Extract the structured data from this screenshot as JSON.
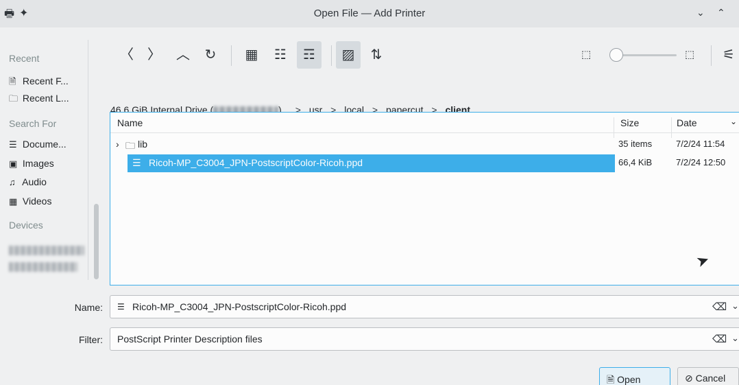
{
  "window": {
    "title": "Open File — Add Printer",
    "left_icons": [
      "printer-icon",
      "pin-icon"
    ],
    "minimize_glyph": "⌄",
    "maximize_glyph": "⌃"
  },
  "places": {
    "recent_header": "Recent",
    "recent_items": [
      {
        "label": "Recent F...",
        "icon": "recent-files-icon"
      },
      {
        "label": "Recent L...",
        "icon": "recent-locations-icon"
      }
    ],
    "search_header": "Search For",
    "search_items": [
      {
        "label": "Docume...",
        "icon": "documents-icon"
      },
      {
        "label": "Images",
        "icon": "images-icon"
      },
      {
        "label": "Audio",
        "icon": "audio-icon"
      },
      {
        "label": "Videos",
        "icon": "videos-icon"
      }
    ],
    "devices_header": "Devices"
  },
  "toolbar": {
    "buttons": [
      "back-icon",
      "forward-icon",
      "up-icon",
      "reload-icon",
      "icons-view-icon",
      "compact-view-icon",
      "details-view-icon",
      "preview-icon",
      "sort-icon"
    ],
    "zoom_level_fraction": 0.05
  },
  "breadcrumb": {
    "drive": "46,6 GiB Internal Drive (",
    "drive_close": ")",
    "parts": [
      "usr",
      "local",
      "papercut"
    ],
    "current": "client",
    "separator": ">"
  },
  "filelist": {
    "columns": {
      "name": "Name",
      "size": "Size",
      "date": "Date"
    },
    "rows": [
      {
        "name": "lib",
        "size": "35 items",
        "date": "7/2/24 11:54",
        "type": "folder"
      },
      {
        "name": "Ricoh-MP_C3004_JPN-PostscriptColor-Ricoh.ppd",
        "size": "66,4 KiB",
        "date": "7/2/24 12:50",
        "type": "file",
        "selected": true
      }
    ]
  },
  "form": {
    "name_label": "Name:",
    "name_value": "Ricoh-MP_C3004_JPN-PostscriptColor-Ricoh.ppd",
    "filter_label": "Filter:",
    "filter_value": "PostScript Printer Description files"
  },
  "buttons": {
    "open": "Open",
    "cancel": "Cancel"
  },
  "colors": {
    "accent": "#3daee9",
    "background": "#eff0f1"
  }
}
